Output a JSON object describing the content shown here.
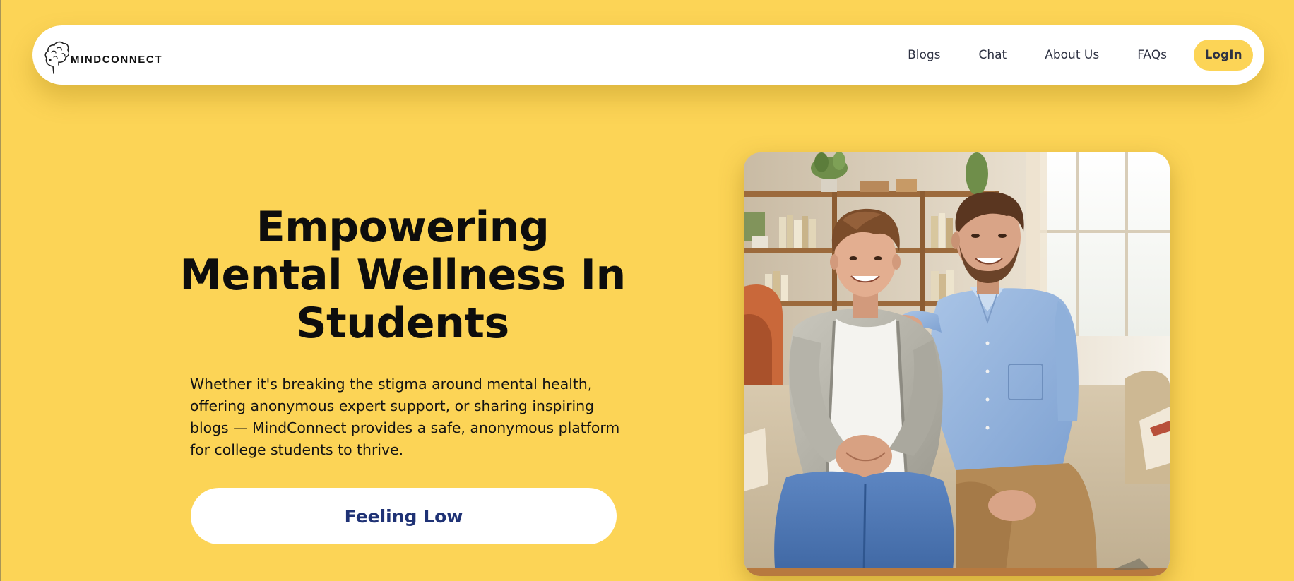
{
  "brand": {
    "name": "MINDCONNECT",
    "icon": "brain-head-icon"
  },
  "nav": {
    "links": [
      "Blogs",
      "Chat",
      "About Us",
      "FAQs"
    ],
    "login_label": "LogIn"
  },
  "hero": {
    "title_lines": [
      "Empowering",
      "Mental Wellness In",
      "Students"
    ],
    "description_lines": [
      "Whether it's breaking the stigma around mental health,",
      "offering anonymous expert support, or sharing inspiring",
      "blogs — MindConnect provides a safe, anonymous platform",
      "for college students to thrive."
    ],
    "cta_label": "Feeling Low"
  },
  "photo": {
    "subject": "smiling student with adult mentor on couch"
  },
  "colors": {
    "background": "#fcd456",
    "nav_background": "#ffffff",
    "nav_text": "#2e3243",
    "cta_text": "#1f3275",
    "heading": "#0d0d0d"
  }
}
